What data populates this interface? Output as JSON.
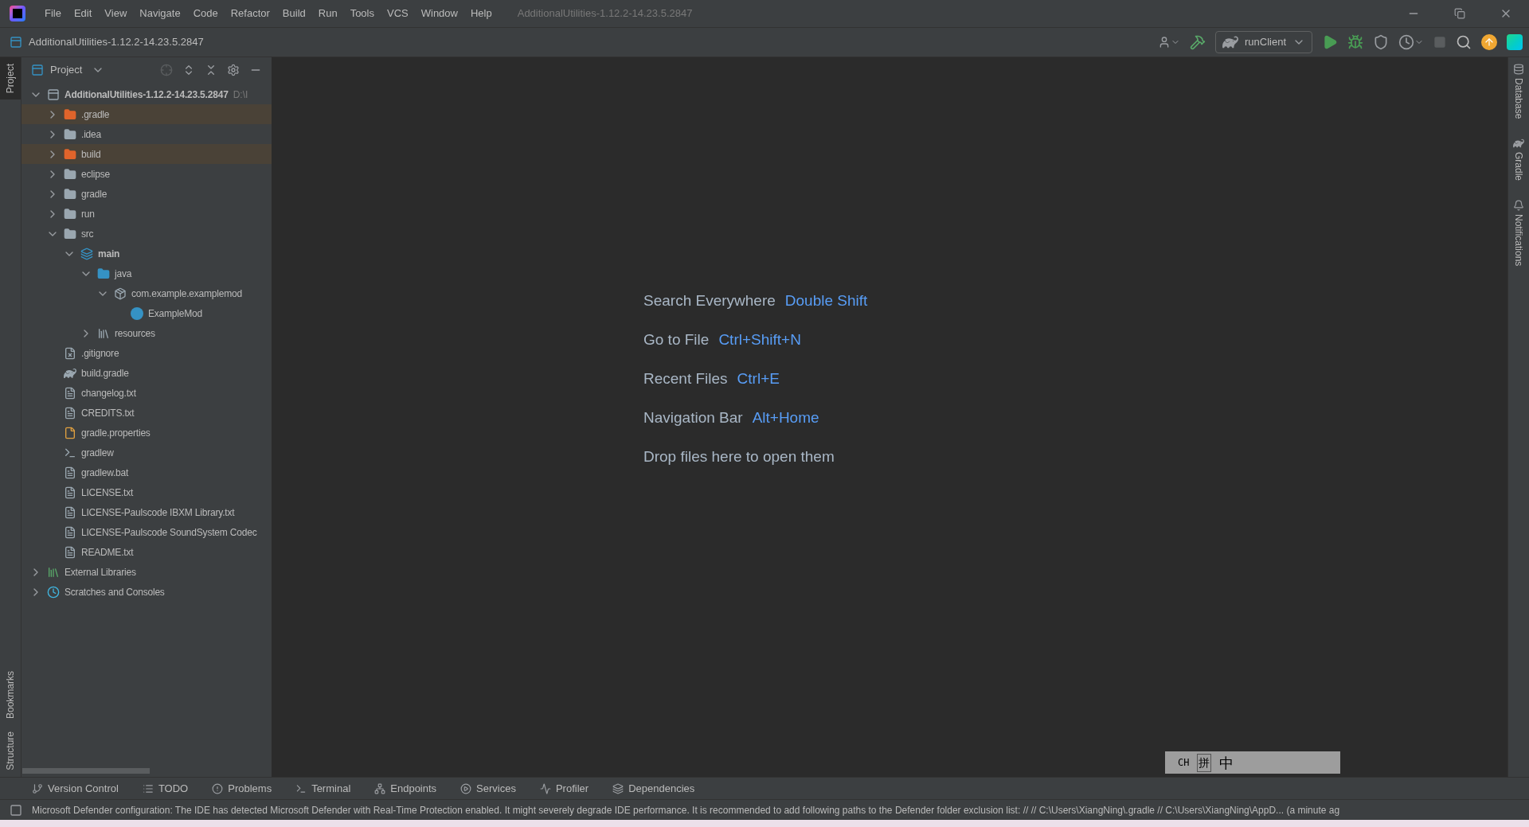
{
  "window": {
    "title": "AdditionalUtilities-1.12.2-14.23.5.2847"
  },
  "menu": [
    "File",
    "Edit",
    "View",
    "Navigate",
    "Code",
    "Refactor",
    "Build",
    "Run",
    "Tools",
    "VCS",
    "Window",
    "Help"
  ],
  "nav_bar": {
    "project": "AdditionalUtilities-1.12.2-14.23.5.2847"
  },
  "toolbar": {
    "run_config": "runClient"
  },
  "left_stripe": [
    {
      "label": "Project",
      "selected": true
    },
    {
      "label": "Bookmarks",
      "selected": false
    },
    {
      "label": "Structure",
      "selected": false
    }
  ],
  "project_panel": {
    "title": "Project",
    "tree": [
      {
        "name": "AdditionalUtilities-1.12.2-14.23.5.2847",
        "hint": "D:\\I",
        "kind": "module",
        "bold": true,
        "expanded": true,
        "children": [
          {
            "name": ".gradle",
            "kind": "folder",
            "excluded": true,
            "expanded": false
          },
          {
            "name": ".idea",
            "kind": "folder",
            "excluded": false,
            "expanded": false
          },
          {
            "name": "build",
            "kind": "folder",
            "excluded": true,
            "expanded": false
          },
          {
            "name": "eclipse",
            "kind": "folder",
            "excluded": false,
            "expanded": false
          },
          {
            "name": "gradle",
            "kind": "folder",
            "excluded": false,
            "expanded": false
          },
          {
            "name": "run",
            "kind": "folder",
            "excluded": false,
            "expanded": false
          },
          {
            "name": "src",
            "kind": "folder",
            "excluded": false,
            "expanded": true,
            "children": [
              {
                "name": "main",
                "kind": "sourceset",
                "bold": true,
                "expanded": true,
                "children": [
                  {
                    "name": "java",
                    "kind": "sourceroot",
                    "expanded": true,
                    "children": [
                      {
                        "name": "com.example.examplemod",
                        "kind": "package",
                        "expanded": true,
                        "children": [
                          {
                            "name": "ExampleMod",
                            "kind": "class"
                          }
                        ]
                      }
                    ]
                  },
                  {
                    "name": "resources",
                    "kind": "resources",
                    "expanded": false
                  }
                ]
              }
            ]
          },
          {
            "name": ".gitignore",
            "kind": "ignore"
          },
          {
            "name": "build.gradle",
            "kind": "gradle"
          },
          {
            "name": "changelog.txt",
            "kind": "text"
          },
          {
            "name": "CREDITS.txt",
            "kind": "text"
          },
          {
            "name": "gradle.properties",
            "kind": "properties"
          },
          {
            "name": "gradlew",
            "kind": "script"
          },
          {
            "name": "gradlew.bat",
            "kind": "text"
          },
          {
            "name": "LICENSE.txt",
            "kind": "text"
          },
          {
            "name": "LICENSE-Paulscode IBXM Library.txt",
            "kind": "text"
          },
          {
            "name": "LICENSE-Paulscode SoundSystem Codec",
            "kind": "text"
          },
          {
            "name": "README.txt",
            "kind": "text"
          }
        ]
      },
      {
        "name": "External Libraries",
        "kind": "libraries",
        "expanded": false
      },
      {
        "name": "Scratches and Consoles",
        "kind": "scratches",
        "expanded": false
      }
    ]
  },
  "welcome": [
    {
      "action": "Search Everywhere",
      "shortcut": "Double Shift"
    },
    {
      "action": "Go to File",
      "shortcut": "Ctrl+Shift+N"
    },
    {
      "action": "Recent Files",
      "shortcut": "Ctrl+E"
    },
    {
      "action": "Navigation Bar",
      "shortcut": "Alt+Home"
    },
    {
      "action": "Drop files here to open them"
    }
  ],
  "right_stripe": [
    "Database",
    "Gradle",
    "Notifications"
  ],
  "tool_windows": [
    {
      "label": "Version Control",
      "kind": "branch"
    },
    {
      "label": "TODO",
      "kind": "list"
    },
    {
      "label": "Problems",
      "kind": "alert"
    },
    {
      "label": "Terminal",
      "kind": "terminal"
    },
    {
      "label": "Endpoints",
      "kind": "endpoints"
    },
    {
      "label": "Services",
      "kind": "services"
    },
    {
      "label": "Profiler",
      "kind": "profiler"
    },
    {
      "label": "Dependencies",
      "kind": "layers"
    }
  ],
  "ime_bar": [
    "CH",
    "拼",
    "中"
  ],
  "status_bar": {
    "message": "Microsoft Defender configuration: The IDE has detected Microsoft Defender with Real-Time Protection enabled. It might severely degrade IDE performance. It is recommended to add following paths to the Defender folder exclusion list: // //  C:\\Users\\XiangNing\\.gradle //  C:\\Users\\XiangNing\\AppD... (a minute ag"
  }
}
